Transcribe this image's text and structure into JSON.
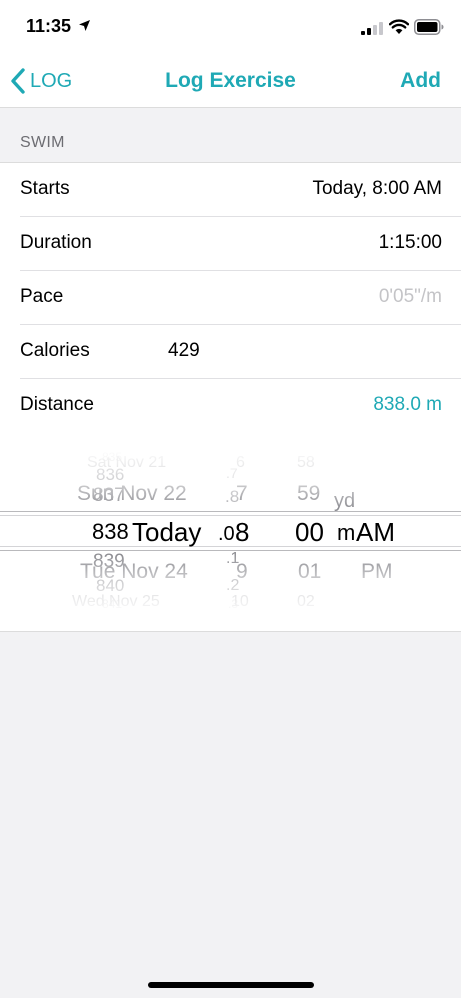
{
  "status_bar": {
    "time": "11:35"
  },
  "nav": {
    "back_label": "LOG",
    "title": "Log Exercise",
    "add_label": "Add"
  },
  "section": {
    "header": "SWIM"
  },
  "rows": [
    {
      "label": "Starts",
      "value": "Today, 8:00 AM"
    },
    {
      "label": "Duration",
      "value": "1:15:00"
    },
    {
      "label": "Pace",
      "placeholder": "0'05\"/m"
    },
    {
      "label": "Calories",
      "value": "429"
    },
    {
      "label": "Distance",
      "value": "838.0 m"
    }
  ],
  "distance_picker": {
    "whole": {
      "above": [
        "835",
        "836",
        "837"
      ],
      "selected": "838",
      "below": [
        "839",
        "840",
        "841"
      ]
    },
    "decimal": {
      "above": [
        ".7",
        ".8"
      ],
      "selected": ".0",
      "below": [
        ".1",
        ".2",
        ".3"
      ]
    },
    "unit": {
      "above": [
        "yd"
      ],
      "selected": "m"
    }
  },
  "date_picker": {
    "date": {
      "above": [
        "Sat Nov 21",
        "Sun Nov 22"
      ],
      "selected": "Today",
      "below": [
        "Tue Nov 24",
        "Wed Nov 25"
      ]
    },
    "hour": {
      "above": [
        "6",
        "7"
      ],
      "selected": "8",
      "below": [
        "9",
        "10"
      ]
    },
    "minute": {
      "above": [
        "58",
        "59"
      ],
      "selected": "00",
      "below": [
        "01",
        "02"
      ]
    },
    "ampm": {
      "selected": "AM",
      "below": [
        "PM"
      ]
    }
  },
  "colors": {
    "accent": "#1fa9b5",
    "placeholder": "#c4c4c7",
    "background": "#f2f2f4"
  },
  "icons": [
    "location-arrow-icon",
    "signal-icon",
    "wifi-icon",
    "battery-icon",
    "chevron-left-icon"
  ]
}
